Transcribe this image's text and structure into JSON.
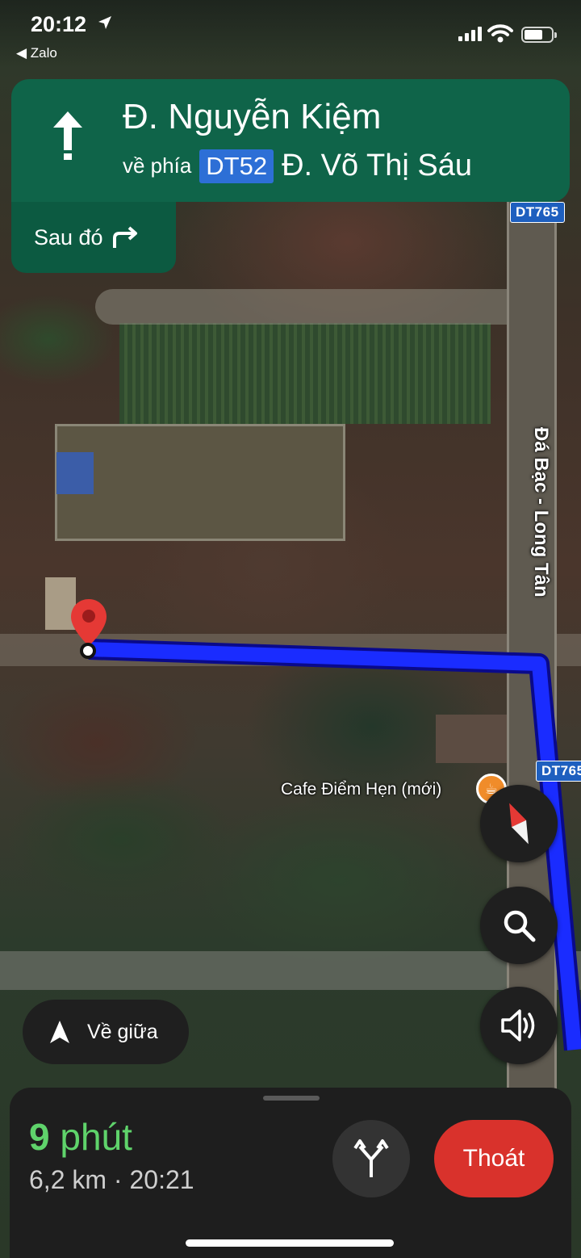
{
  "status_bar": {
    "time": "20:12",
    "back_app": "◀ Zalo"
  },
  "navigation": {
    "street": "Đ. Nguyễn Kiệm",
    "toward_label": "về phía",
    "toward_shield": "DT52",
    "toward_road": "Đ. Võ Thị Sáu",
    "then_label": "Sau đó",
    "banner_color": "#0f6449"
  },
  "map": {
    "road_shield_1": "DT765",
    "road_shield_2": "DT765",
    "road_name": "Đá Bạc - Long Tân",
    "poi_label": "Cafe Điểm Hẹn (mới)",
    "route_color": "#1a2cff"
  },
  "controls": {
    "recenter_label": "Về giữa",
    "compass_icon": "compass-icon",
    "search_icon": "search-icon",
    "sound_icon": "speaker-icon"
  },
  "bottom_sheet": {
    "eta_number": "9",
    "eta_unit": "phút",
    "eta_detail": "6,2 km · 20:21",
    "exit_label": "Thoát",
    "eta_color": "#5fd36b",
    "exit_color": "#d9322c"
  }
}
